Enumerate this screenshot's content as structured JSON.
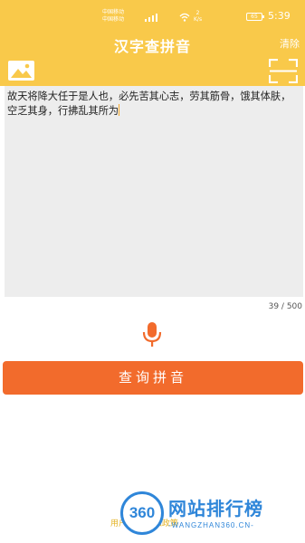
{
  "status_bar": {
    "carrier_1": "中国移动",
    "carrier_2": "中国移动",
    "net_speed_value": "2",
    "net_speed_unit": "K/s",
    "battery": "65",
    "time": "5:39"
  },
  "header": {
    "title": "汉字查拼音",
    "clear_label": "清除"
  },
  "input": {
    "text": "故天将降大任于是人也，必先苦其心志，劳其筋骨，饿其体肤，空乏其身，行拂乱其所为",
    "counter": "39 / 500"
  },
  "actions": {
    "query_label": "查询拼音"
  },
  "footer": {
    "privacy_link": "用户协议 隐私政策"
  },
  "watermark": {
    "badge": "360",
    "title": "网站排行榜",
    "subtitle": "-WANGZHAN360.CN-"
  },
  "colors": {
    "header_bg": "#f9c94a",
    "accent": "#f26b2c",
    "text_area_bg": "#ededed",
    "watermark_blue": "#2f86d9"
  },
  "icons": {
    "image_button": "image-icon",
    "scan_button": "scan-icon",
    "mic_button": "microphone-icon"
  }
}
